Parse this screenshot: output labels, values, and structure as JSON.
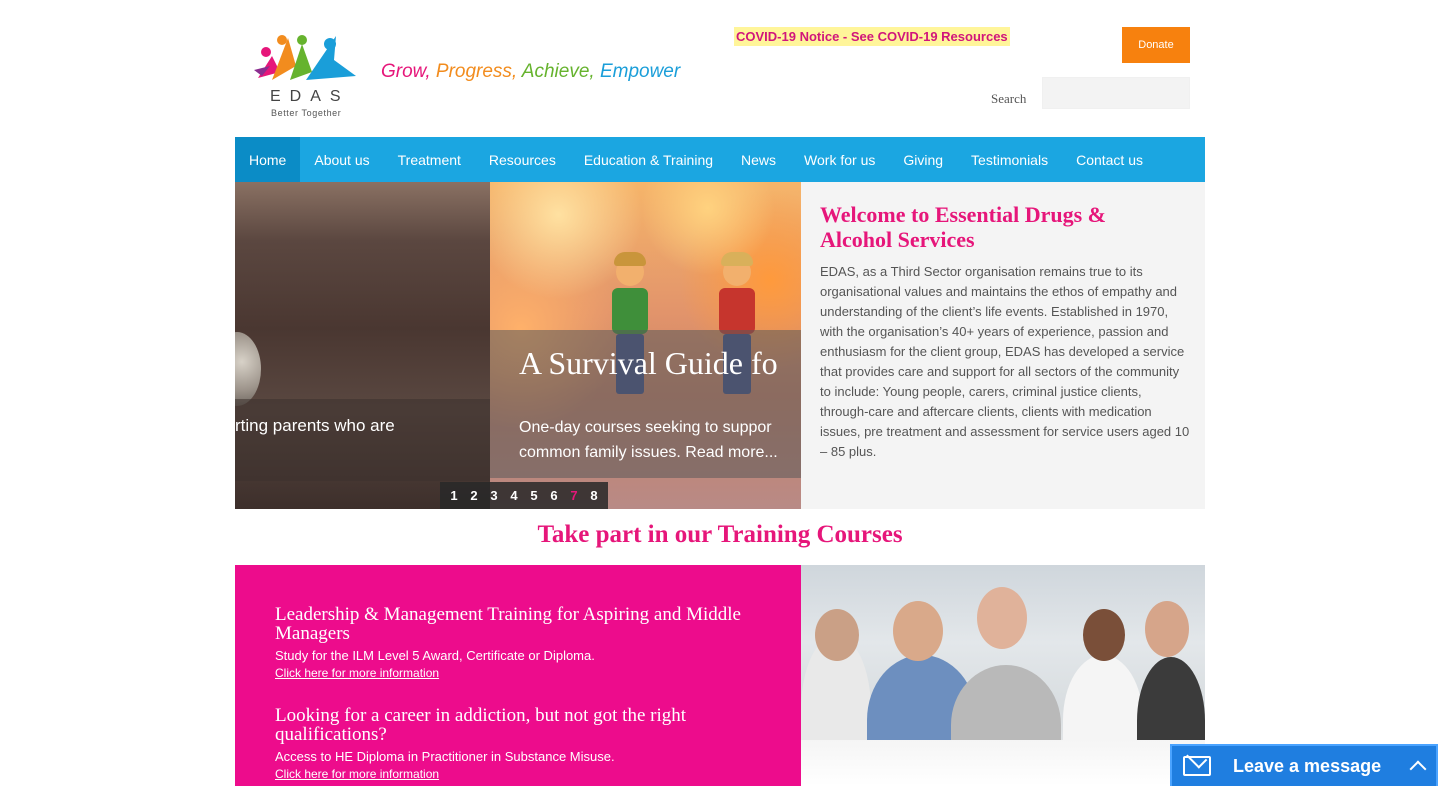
{
  "header": {
    "logo_name": "EDAS",
    "logo_sub": "Better Together",
    "tagline": {
      "grow": "Grow,",
      "progress": "Progress,",
      "achieve": "Achieve,",
      "empower": "Empower"
    },
    "covid_notice": "COVID-19 Notice - See COVID-19 Resources",
    "donate_label": "Donate",
    "search_label": "Search",
    "search_placeholder": ""
  },
  "nav": {
    "items": [
      {
        "label": "Home",
        "active": true
      },
      {
        "label": "About us"
      },
      {
        "label": "Treatment"
      },
      {
        "label": "Resources"
      },
      {
        "label": "Education & Training"
      },
      {
        "label": "News"
      },
      {
        "label": "Work for us"
      },
      {
        "label": "Giving"
      },
      {
        "label": "Testimonials"
      },
      {
        "label": "Contact us"
      }
    ]
  },
  "slider": {
    "prev_slide_text": "rting parents who are",
    "title": "A Survival Guide fo",
    "text_line1": "One-day courses seeking to suppor",
    "text_line2": "common family issues. Read more...",
    "pages": [
      "1",
      "2",
      "3",
      "4",
      "5",
      "6",
      "7",
      "8"
    ],
    "current_page": "7"
  },
  "welcome": {
    "title": "Welcome to Essential Drugs & Alcohol Services",
    "body": "EDAS, as a Third Sector organisation remains true to its organisational values and maintains the ethos of empathy and understanding of the client’s life events. Established in 1970, with the organisation’s 40+ years of experience, passion and enthusiasm for the client group, EDAS has developed a service that provides care and support for all sectors of the community to include: Young people, carers, criminal justice clients, through-care and aftercare clients, clients with medication issues, pre treatment and assessment for service users aged 10 – 85 plus."
  },
  "training": {
    "heading": "Take part in our Training Courses",
    "courses": [
      {
        "title": "Leadership & Management Training for Aspiring and Middle Managers",
        "desc": "Study for the ILM Level 5 Award, Certificate or Diploma.",
        "link": "Click here for more information"
      },
      {
        "title": "Looking for a career in addiction, but not got the right qualifications?",
        "desc": "Access to HE Diploma in Practitioner in Substance Misuse.",
        "link": "Click here for more information"
      }
    ]
  },
  "chat": {
    "label": "Leave a message",
    "icon": "envelope-icon"
  },
  "colors": {
    "brand_pink": "#e6167a",
    "nav_blue": "#1ba6e1",
    "donate_orange": "#f7810e",
    "training_pink": "#ed0c8c",
    "chat_blue": "#1f7ee0"
  }
}
